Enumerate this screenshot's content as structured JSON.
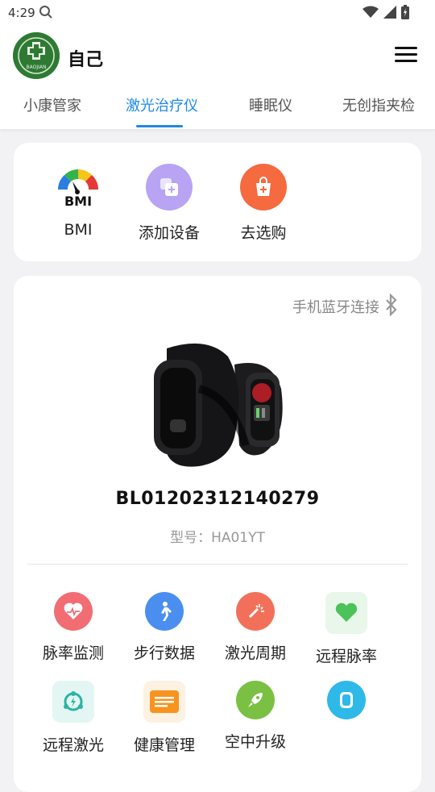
{
  "status_bar": {
    "time": "4:29"
  },
  "header": {
    "user_name": "自己",
    "avatar_text": "BAOJIAN"
  },
  "tabs": [
    {
      "label": "小康管家",
      "active": false
    },
    {
      "label": "激光治疗仪",
      "active": true
    },
    {
      "label": "睡眠仪",
      "active": false
    },
    {
      "label": "无创指夹检",
      "active": false
    }
  ],
  "quick_actions": [
    {
      "label": "BMI",
      "icon": "bmi-gauge-icon",
      "icon_text": "BMI"
    },
    {
      "label": "添加设备",
      "icon": "add-device-icon",
      "color": "#b39cf0"
    },
    {
      "label": "去选购",
      "icon": "shopping-bag-icon",
      "color": "#f5673c"
    }
  ],
  "device": {
    "bluetooth_label": "手机蓝牙连接",
    "serial": "BL01202312140279",
    "model": "型号：HA01YT"
  },
  "functions": [
    {
      "label": "脉率监测",
      "icon": "heart-pulse-icon",
      "color": "#f26d73"
    },
    {
      "label": "步行数据",
      "icon": "walking-icon",
      "color": "#4a8ff0"
    },
    {
      "label": "激光周期",
      "icon": "laser-icon",
      "color": "#f2705a"
    },
    {
      "label": "远程脉率",
      "icon": "heart-icon",
      "color": "#4cc35a"
    },
    {
      "label": "远程激光",
      "icon": "remote-laser-icon",
      "color": "#2bb5a2"
    },
    {
      "label": "健康管理",
      "icon": "health-card-icon",
      "color": "#f7931e"
    },
    {
      "label": "空中升级",
      "icon": "rocket-icon",
      "color": "#7ac143"
    },
    {
      "label": "",
      "icon": "watch-icon",
      "color": "#2eb9e8"
    }
  ]
}
